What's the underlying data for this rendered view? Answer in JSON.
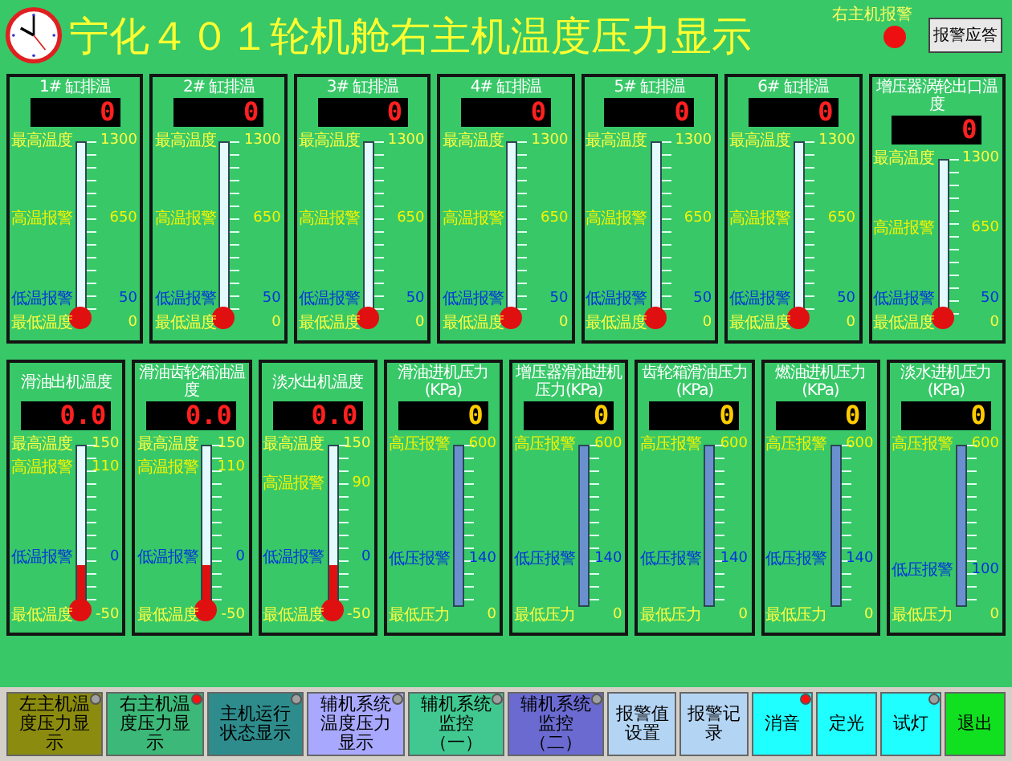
{
  "header": {
    "title": "宁化４０１轮机舱右主机温度压力显示",
    "alarm_label": "右主机报警",
    "alarm_lit": true,
    "ack_button": "报警应答"
  },
  "top_gauges": [
    {
      "title": "1# 缸排温",
      "kind": "temperature",
      "reading": "0",
      "level": 0,
      "marks": [
        {
          "label": "最高温度",
          "value": "1300",
          "kind": "limit"
        },
        {
          "label": "高温报警",
          "value": "650",
          "kind": "high_alarm"
        },
        {
          "label": "低温报警",
          "value": "50",
          "kind": "low_alarm"
        },
        {
          "label": "最低温度",
          "value": "0",
          "kind": "limit"
        }
      ]
    },
    {
      "title": "2# 缸排温",
      "kind": "temperature",
      "reading": "0",
      "level": 0,
      "marks": [
        {
          "label": "最高温度",
          "value": "1300",
          "kind": "limit"
        },
        {
          "label": "高温报警",
          "value": "650",
          "kind": "high_alarm"
        },
        {
          "label": "低温报警",
          "value": "50",
          "kind": "low_alarm"
        },
        {
          "label": "最低温度",
          "value": "0",
          "kind": "limit"
        }
      ]
    },
    {
      "title": "3# 缸排温",
      "kind": "temperature",
      "reading": "0",
      "level": 0,
      "marks": [
        {
          "label": "最高温度",
          "value": "1300",
          "kind": "limit"
        },
        {
          "label": "高温报警",
          "value": "650",
          "kind": "high_alarm"
        },
        {
          "label": "低温报警",
          "value": "50",
          "kind": "low_alarm"
        },
        {
          "label": "最低温度",
          "value": "0",
          "kind": "limit"
        }
      ]
    },
    {
      "title": "4# 缸排温",
      "kind": "temperature",
      "reading": "0",
      "level": 0,
      "marks": [
        {
          "label": "最高温度",
          "value": "1300",
          "kind": "limit"
        },
        {
          "label": "高温报警",
          "value": "650",
          "kind": "high_alarm"
        },
        {
          "label": "低温报警",
          "value": "50",
          "kind": "low_alarm"
        },
        {
          "label": "最低温度",
          "value": "0",
          "kind": "limit"
        }
      ]
    },
    {
      "title": "5# 缸排温",
      "kind": "temperature",
      "reading": "0",
      "level": 0,
      "marks": [
        {
          "label": "最高温度",
          "value": "1300",
          "kind": "limit"
        },
        {
          "label": "高温报警",
          "value": "650",
          "kind": "high_alarm"
        },
        {
          "label": "低温报警",
          "value": "50",
          "kind": "low_alarm"
        },
        {
          "label": "最低温度",
          "value": "0",
          "kind": "limit"
        }
      ]
    },
    {
      "title": "6# 缸排温",
      "kind": "temperature",
      "reading": "0",
      "level": 0,
      "marks": [
        {
          "label": "最高温度",
          "value": "1300",
          "kind": "limit"
        },
        {
          "label": "高温报警",
          "value": "650",
          "kind": "high_alarm"
        },
        {
          "label": "低温报警",
          "value": "50",
          "kind": "low_alarm"
        },
        {
          "label": "最低温度",
          "value": "0",
          "kind": "limit"
        }
      ]
    },
    {
      "title": "增压器涡轮出口温度",
      "kind": "temperature",
      "reading": "0",
      "level": 0,
      "marks": [
        {
          "label": "最高温度",
          "value": "1300",
          "kind": "limit"
        },
        {
          "label": "高温报警",
          "value": "650",
          "kind": "high_alarm"
        },
        {
          "label": "低温报警",
          "value": "50",
          "kind": "low_alarm"
        },
        {
          "label": "最低温度",
          "value": "0",
          "kind": "limit"
        }
      ]
    }
  ],
  "bottom_gauges": [
    {
      "title": "滑油出机温度",
      "kind": "temperature",
      "reading": "0.0",
      "level": 0.25,
      "marks": [
        {
          "label": "最高温度",
          "value": "150",
          "kind": "limit"
        },
        {
          "label": "高温报警",
          "value": "110",
          "kind": "high_alarm"
        },
        {
          "label": "低温报警",
          "value": "0",
          "kind": "low_alarm"
        },
        {
          "label": "最低温度",
          "value": "-50",
          "kind": "limit"
        }
      ]
    },
    {
      "title": "滑油齿轮箱油温度",
      "kind": "temperature",
      "reading": "0.0",
      "level": 0.25,
      "marks": [
        {
          "label": "最高温度",
          "value": "150",
          "kind": "limit"
        },
        {
          "label": "高温报警",
          "value": "110",
          "kind": "high_alarm"
        },
        {
          "label": "低温报警",
          "value": "0",
          "kind": "low_alarm"
        },
        {
          "label": "最低温度",
          "value": "-50",
          "kind": "limit"
        }
      ]
    },
    {
      "title": "淡水出机温度",
      "kind": "temperature",
      "reading": "0.0",
      "level": 0.25,
      "marks": [
        {
          "label": "最高温度",
          "value": "150",
          "kind": "limit"
        },
        {
          "label": "高温报警",
          "value": "90",
          "kind": "high_alarm"
        },
        {
          "label": "低温报警",
          "value": "0",
          "kind": "low_alarm"
        },
        {
          "label": "最低温度",
          "value": "-50",
          "kind": "limit"
        }
      ]
    },
    {
      "title": "滑油进机压力(KPa)",
      "kind": "pressure",
      "reading": "0",
      "level": 0,
      "marks": [
        {
          "label": "高压报警",
          "value": "600",
          "kind": "high_alarm"
        },
        {
          "label": "低压报警",
          "value": "140",
          "kind": "low_alarm"
        },
        {
          "label": "最低压力",
          "value": "0",
          "kind": "limit"
        }
      ]
    },
    {
      "title": "增压器滑油进机压力(KPa)",
      "kind": "pressure",
      "reading": "0",
      "level": 0,
      "marks": [
        {
          "label": "高压报警",
          "value": "600",
          "kind": "high_alarm"
        },
        {
          "label": "低压报警",
          "value": "140",
          "kind": "low_alarm"
        },
        {
          "label": "最低压力",
          "value": "0",
          "kind": "limit"
        }
      ]
    },
    {
      "title": "齿轮箱滑油压力(KPa)",
      "kind": "pressure",
      "reading": "0",
      "level": 0,
      "marks": [
        {
          "label": "高压报警",
          "value": "600",
          "kind": "high_alarm"
        },
        {
          "label": "低压报警",
          "value": "140",
          "kind": "low_alarm"
        },
        {
          "label": "最低压力",
          "value": "0",
          "kind": "limit"
        }
      ]
    },
    {
      "title": "燃油进机压力(KPa)",
      "kind": "pressure",
      "reading": "0",
      "level": 0,
      "marks": [
        {
          "label": "高压报警",
          "value": "600",
          "kind": "high_alarm"
        },
        {
          "label": "低压报警",
          "value": "140",
          "kind": "low_alarm"
        },
        {
          "label": "最低压力",
          "value": "0",
          "kind": "limit"
        }
      ]
    },
    {
      "title": "淡水进机压力(KPa)",
      "kind": "pressure",
      "reading": "0",
      "level": 0,
      "marks": [
        {
          "label": "高压报警",
          "value": "600",
          "kind": "high_alarm"
        },
        {
          "label": "低压报警",
          "value": "100",
          "kind": "low_alarm"
        },
        {
          "label": "最低压力",
          "value": "0",
          "kind": "limit"
        }
      ]
    }
  ],
  "buttons": [
    {
      "label": "左主机温度压力显示",
      "kind": "indicator",
      "lit": false,
      "color": "#8b8b10"
    },
    {
      "label": "右主机温度压力显示",
      "kind": "indicator",
      "lit": true,
      "color": "#3cb878"
    },
    {
      "label": "主机运行状态显示",
      "kind": "indicator",
      "lit": false,
      "color": "#2e8c8c"
    },
    {
      "label": "辅机系统温度压力显示",
      "kind": "indicator",
      "lit": false,
      "color": "#a8a8ff"
    },
    {
      "label": "辅机系统监控（一）",
      "kind": "indicator",
      "lit": false,
      "color": "#40c890"
    },
    {
      "label": "辅机系统监控（二）",
      "kind": "indicator",
      "lit": false,
      "color": "#6a6ad0"
    },
    {
      "label": "报警值设置",
      "kind": "plain",
      "color": "#b4d4f4"
    },
    {
      "label": "报警记录",
      "kind": "plain",
      "color": "#b4d4f4"
    },
    {
      "label": "消音",
      "kind": "indicator",
      "lit": true,
      "color": "#20ffff"
    },
    {
      "label": "定光",
      "kind": "plain",
      "color": "#20ffff"
    },
    {
      "label": "试灯",
      "kind": "indicator",
      "lit": false,
      "color": "#20ffff"
    },
    {
      "label": "退出",
      "kind": "plain",
      "color": "#10e020"
    }
  ]
}
